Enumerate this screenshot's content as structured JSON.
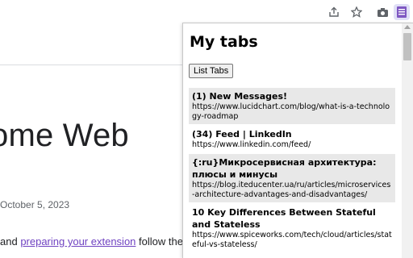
{
  "toolbar": {
    "icons": [
      "share-icon",
      "star-icon",
      "camera-icon",
      "extension-icon"
    ],
    "accent": "#7e57c2"
  },
  "page": {
    "title_fragment": "ome Web",
    "date_fragment": "October 5, 2023",
    "body_prefix": "and ",
    "body_link": "preparing your extension",
    "body_suffix": " follow the"
  },
  "popup": {
    "title": "My tabs",
    "list_button": "List Tabs",
    "tabs": [
      {
        "title": "(1) New Messages!",
        "url": "https://www.lucidchart.com/blog/what-is-a-technology-roadmap"
      },
      {
        "title": "(34) Feed | LinkedIn",
        "url": "https://www.linkedin.com/feed/"
      },
      {
        "title": "{:ru}Микросервисная архитектура: плюсы и минусы",
        "url": "https://blog.iteducenter.ua/ru/articles/microservices-architecture-advantages-and-disadvantages/"
      },
      {
        "title": "10 Key Differences Between Stateful and Stateless",
        "url": "https://www.spiceworks.com/tech/cloud/articles/stateful-vs-stateless/"
      }
    ]
  }
}
